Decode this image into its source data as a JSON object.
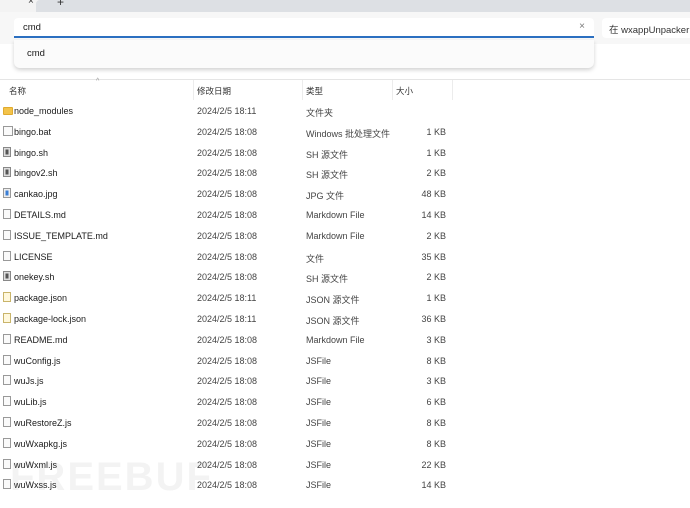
{
  "tabbar": {
    "close_icon": "×",
    "new_tab_icon": "+"
  },
  "search": {
    "value": "cmd",
    "clear_icon": "×"
  },
  "location_button": "在 wxappUnpacker",
  "suggestions": [
    "cmd"
  ],
  "columns": {
    "name": "名称",
    "date": "修改日期",
    "type": "类型",
    "size": "大小"
  },
  "files": [
    {
      "icon": "folder",
      "name": "node_modules",
      "date": "2024/2/5 18:11",
      "type": "文件夹",
      "size": ""
    },
    {
      "icon": "bat",
      "name": "bingo.bat",
      "date": "2024/2/5 18:08",
      "type": "Windows 批处理文件",
      "size": "1 KB"
    },
    {
      "icon": "sh",
      "name": "bingo.sh",
      "date": "2024/2/5 18:08",
      "type": "SH 源文件",
      "size": "1 KB"
    },
    {
      "icon": "sh",
      "name": "bingov2.sh",
      "date": "2024/2/5 18:08",
      "type": "SH 源文件",
      "size": "2 KB"
    },
    {
      "icon": "jpg",
      "name": "cankao.jpg",
      "date": "2024/2/5 18:08",
      "type": "JPG 文件",
      "size": "48 KB"
    },
    {
      "icon": "md",
      "name": "DETAILS.md",
      "date": "2024/2/5 18:08",
      "type": "Markdown File",
      "size": "14 KB"
    },
    {
      "icon": "md",
      "name": "ISSUE_TEMPLATE.md",
      "date": "2024/2/5 18:08",
      "type": "Markdown File",
      "size": "2 KB"
    },
    {
      "icon": "file",
      "name": "LICENSE",
      "date": "2024/2/5 18:08",
      "type": "文件",
      "size": "35 KB"
    },
    {
      "icon": "sh",
      "name": "onekey.sh",
      "date": "2024/2/5 18:08",
      "type": "SH 源文件",
      "size": "2 KB"
    },
    {
      "icon": "json",
      "name": "package.json",
      "date": "2024/2/5 18:11",
      "type": "JSON 源文件",
      "size": "1 KB"
    },
    {
      "icon": "json",
      "name": "package-lock.json",
      "date": "2024/2/5 18:11",
      "type": "JSON 源文件",
      "size": "36 KB"
    },
    {
      "icon": "md",
      "name": "README.md",
      "date": "2024/2/5 18:08",
      "type": "Markdown File",
      "size": "3 KB"
    },
    {
      "icon": "js",
      "name": "wuConfig.js",
      "date": "2024/2/5 18:08",
      "type": "JSFile",
      "size": "8 KB"
    },
    {
      "icon": "js",
      "name": "wuJs.js",
      "date": "2024/2/5 18:08",
      "type": "JSFile",
      "size": "3 KB"
    },
    {
      "icon": "js",
      "name": "wuLib.js",
      "date": "2024/2/5 18:08",
      "type": "JSFile",
      "size": "6 KB"
    },
    {
      "icon": "js",
      "name": "wuRestoreZ.js",
      "date": "2024/2/5 18:08",
      "type": "JSFile",
      "size": "8 KB"
    },
    {
      "icon": "js",
      "name": "wuWxapkg.js",
      "date": "2024/2/5 18:08",
      "type": "JSFile",
      "size": "8 KB"
    },
    {
      "icon": "js",
      "name": "wuWxml.js",
      "date": "2024/2/5 18:08",
      "type": "JSFile",
      "size": "22 KB"
    },
    {
      "icon": "js",
      "name": "wuWxss.js",
      "date": "2024/2/5 18:08",
      "type": "JSFile",
      "size": "14 KB"
    }
  ],
  "watermark": "FREEBUF"
}
